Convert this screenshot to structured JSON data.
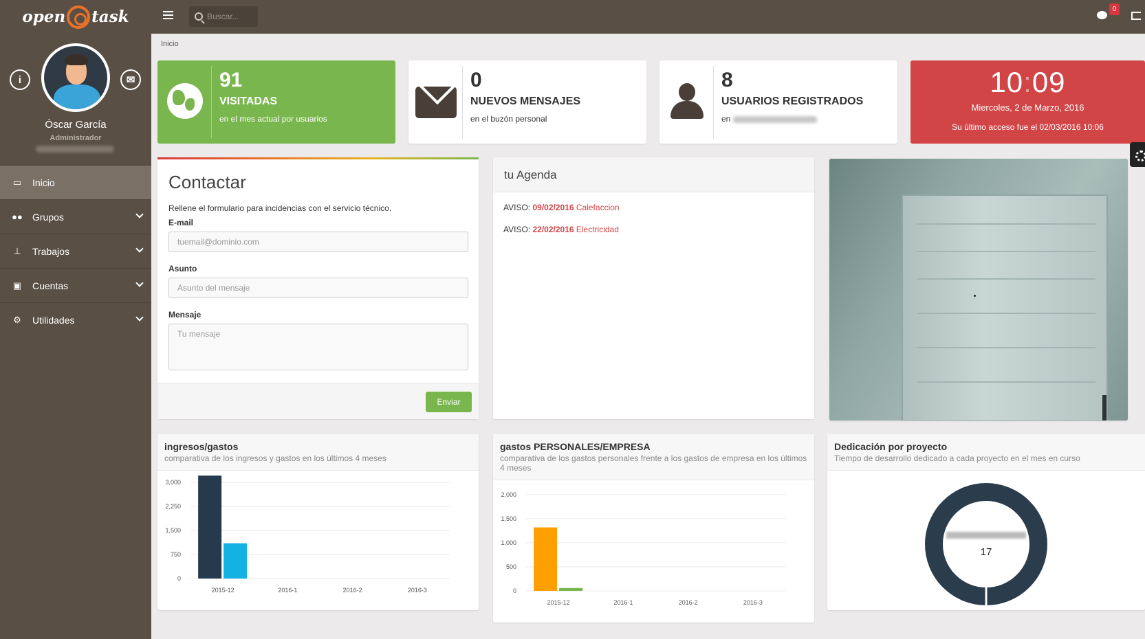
{
  "brand": {
    "left": "open",
    "right": "task"
  },
  "user": {
    "name": "Óscar García",
    "role": "Administrador"
  },
  "nav": [
    {
      "label": "Inicio",
      "icon": "monitor-icon",
      "active": true
    },
    {
      "label": "Grupos",
      "icon": "users-icon",
      "active": false
    },
    {
      "label": "Trabajos",
      "icon": "sitemap-icon",
      "active": false
    },
    {
      "label": "Cuentas",
      "icon": "inbox-icon",
      "active": false
    },
    {
      "label": "Utilidades",
      "icon": "cogs-icon",
      "active": false
    }
  ],
  "topbar": {
    "search_placeholder": "Buscar...",
    "notifications": "0"
  },
  "breadcrumb": "Inicio",
  "stats": {
    "visits": {
      "value": "91",
      "title": "VISITADAS",
      "subtitle": "en el mes actual por usuarios"
    },
    "messages": {
      "value": "0",
      "title": "NUEVOS MENSAJES",
      "subtitle": "en el buzón personal"
    },
    "users": {
      "value": "8",
      "title": "USUARIOS REGISTRADOS",
      "subtitle": "en"
    },
    "clock": {
      "hours": "10",
      "separator": ":",
      "minutes": "09",
      "date": "Miercoles, 2 de Marzo, 2016",
      "last_access": "Su último acceso fue el 02/03/2016 10:06"
    }
  },
  "contact": {
    "title": "Contactar",
    "description": "Rellene el formulario para incidencias con el servicio técnico.",
    "email_label": "E-mail",
    "email_placeholder": "tuemail@dominio.com",
    "subject_label": "Asunto",
    "subject_placeholder": "Asunto del mensaje",
    "message_label": "Mensaje",
    "message_placeholder": "Tu mensaje",
    "send_label": "Enviar"
  },
  "agenda": {
    "title": "tu Agenda",
    "items": [
      {
        "prefix": "AVISO:",
        "date": "09/02/2016",
        "event": "Calefaccion"
      },
      {
        "prefix": "AVISO:",
        "date": "22/02/2016",
        "event": "Electricidad"
      }
    ]
  },
  "charts": {
    "income": {
      "title": "ingresos/gastos",
      "subtitle": "comparativa de los ingresos y gastos en los últimos 4 meses"
    },
    "expenses": {
      "title": "gastos PERSONALES/EMPRESA",
      "subtitle": "comparativa de los gastos personales frente a los gastos de empresa en los últimos 4 meses"
    },
    "dedication": {
      "title": "Dedicación por proyecto",
      "subtitle": "Tiempo de desarrollo dedicado a cada proyecto en el mes en curso"
    }
  },
  "chart_data": [
    {
      "type": "bar",
      "categories": [
        "2015-12",
        "2016-1",
        "2016-2",
        "2016-3"
      ],
      "series": [
        {
          "values": [
            3250,
            0,
            0,
            0
          ],
          "color": "#253a4c"
        },
        {
          "values": [
            1100,
            0,
            0,
            0
          ],
          "color": "#12b2e3"
        }
      ],
      "ylim": [
        0,
        3000
      ],
      "yticks": [
        "0",
        "750",
        "1,500",
        "2,250",
        "3,000"
      ],
      "ytick_values": [
        0,
        750,
        1500,
        2250,
        3000
      ]
    },
    {
      "type": "bar",
      "categories": [
        "2015-12",
        "2016-1",
        "2016-2",
        "2016-3"
      ],
      "series": [
        {
          "values": [
            1320,
            0,
            0,
            0
          ],
          "color": "#ff9f00"
        },
        {
          "values": [
            60,
            0,
            0,
            0
          ],
          "color": "#79b74e"
        }
      ],
      "ylim": [
        0,
        2000
      ],
      "yticks": [
        "0",
        "500",
        "1,000",
        "1,500",
        "2,000"
      ],
      "ytick_values": [
        0,
        500,
        1000,
        1500,
        2000
      ]
    },
    {
      "type": "pie",
      "slices": [
        {
          "value": 17,
          "color": "#2b3d4d"
        }
      ],
      "center_value": "17"
    }
  ]
}
